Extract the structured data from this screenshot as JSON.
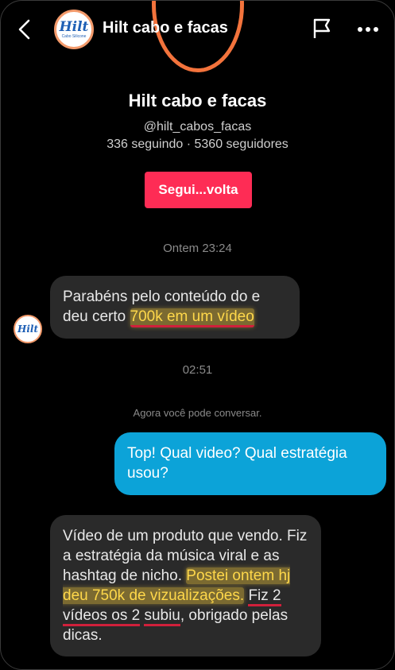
{
  "header": {
    "title": "Hilt cabo e facas",
    "avatar_logo": "Hilt",
    "avatar_logo_sub": "Cabo Silicone"
  },
  "profile": {
    "name": "Hilt cabo e facas",
    "handle": "@hilt_cabos_facas",
    "stats": "336 seguindo · 5360 seguidores",
    "follow_label": "Segui...volta"
  },
  "chat": {
    "timestamp_1": "Ontem 23:24",
    "msg1_part1": "Parabéns pelo conteúdo do e deu certo ",
    "msg1_highlight": "700k em um vídeo",
    "timestamp_2": "02:51",
    "system_message": "Agora você pode conversar.",
    "msg2": "Top! Qual video? Qual estratégia usou?",
    "msg3_part1": "Vídeo de um produto que vendo. Fiz a estratégia da música viral e as hashtag de nicho. ",
    "msg3_highlight": "Postei ontem hj deu 750k de vizualizações.",
    "msg3_space": " ",
    "msg3_underline1": "Fiz 2 vídeos os 2",
    "msg3_space2": " ",
    "msg3_underline2": "subiu",
    "msg3_part2": ", obrigado pelas dicas."
  },
  "icons": {
    "back": "chevron-left-icon",
    "report": "flag-icon",
    "more": "more-horizontal-icon"
  },
  "colors": {
    "accent": "#fe2c55",
    "outgoing_bubble": "#0ca3d8",
    "incoming_bubble": "#2a2a2a",
    "highlight": "#ffd84a",
    "underline": "#d0203b"
  }
}
